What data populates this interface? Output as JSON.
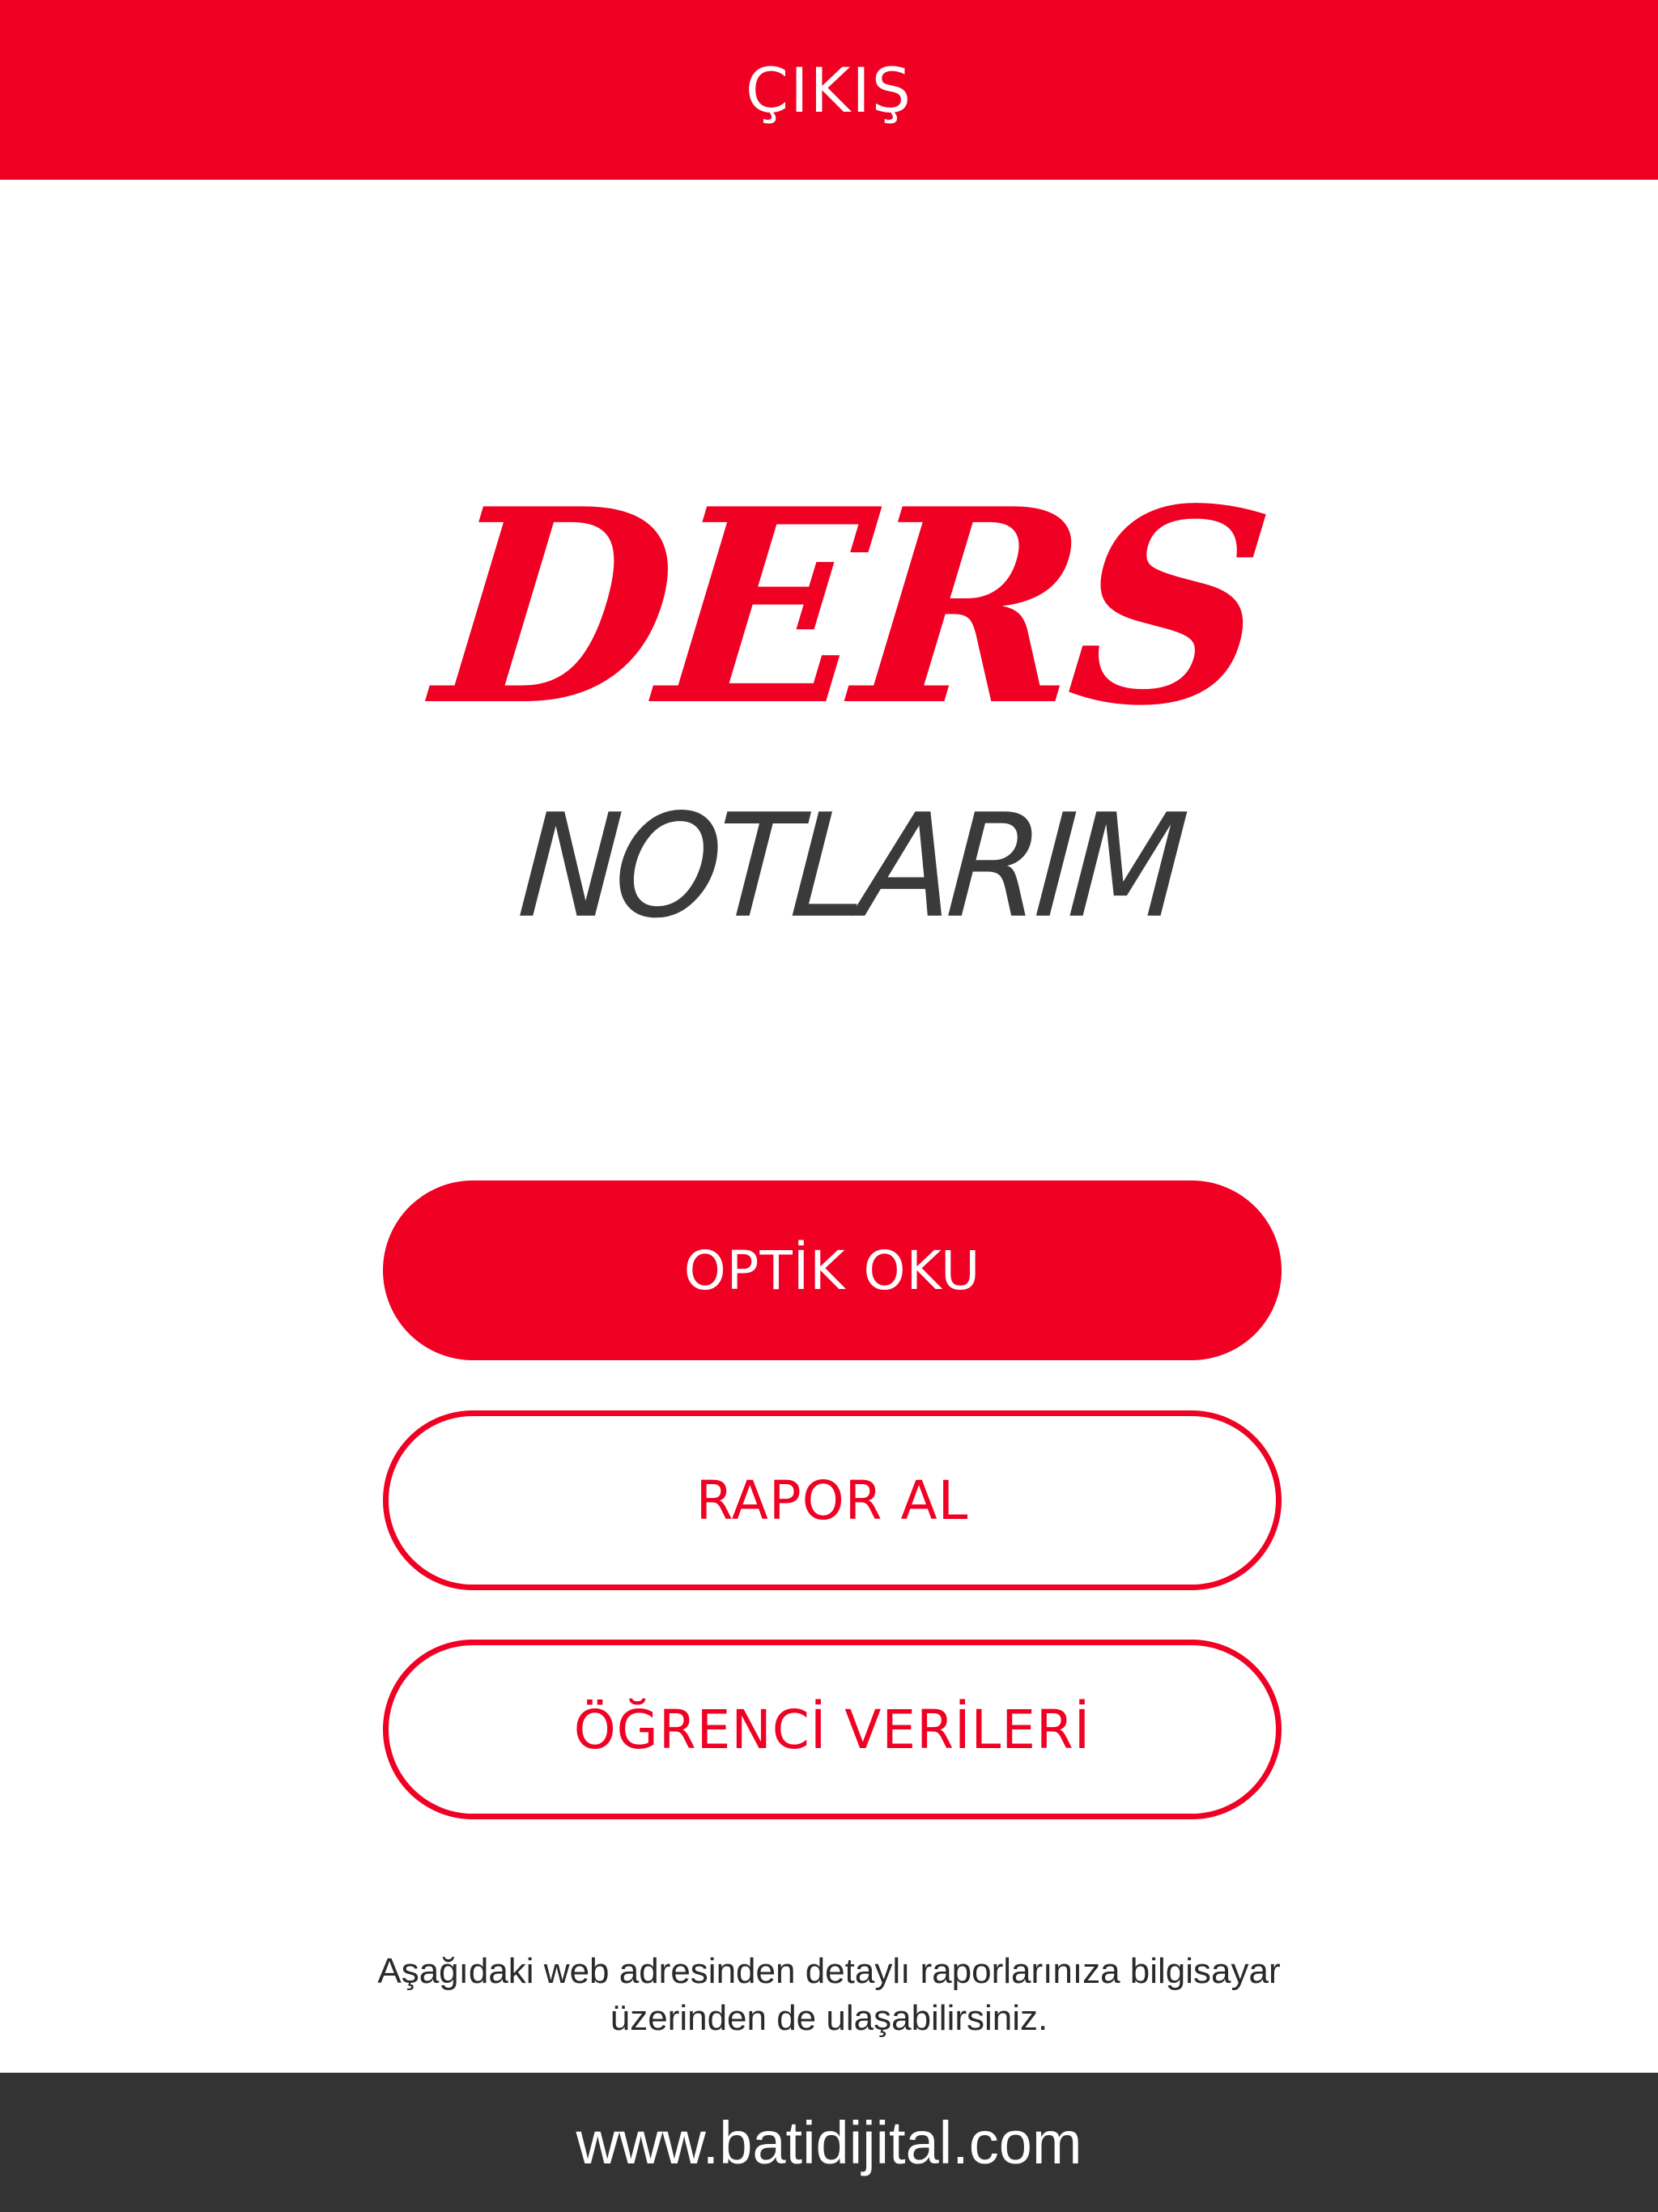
{
  "header": {
    "exit_label": "ÇIKIŞ"
  },
  "logo": {
    "line1": "DERS",
    "line2": "NOTLARIM"
  },
  "buttons": {
    "scan_label": "OPTİK OKU",
    "report_label": "RAPOR AL",
    "students_label": "ÖĞRENCİ VERİLERİ"
  },
  "info": {
    "line1": "Aşağıdaki web adresinden detaylı raporlarınıza bilgisayar",
    "line2": "üzerinden de ulaşabilirsiniz."
  },
  "footer": {
    "url": "www.batidijital.com"
  },
  "colors": {
    "brand_red": "#f00023",
    "footer_dark": "#333333",
    "logo_gray": "#3a3a3a"
  }
}
